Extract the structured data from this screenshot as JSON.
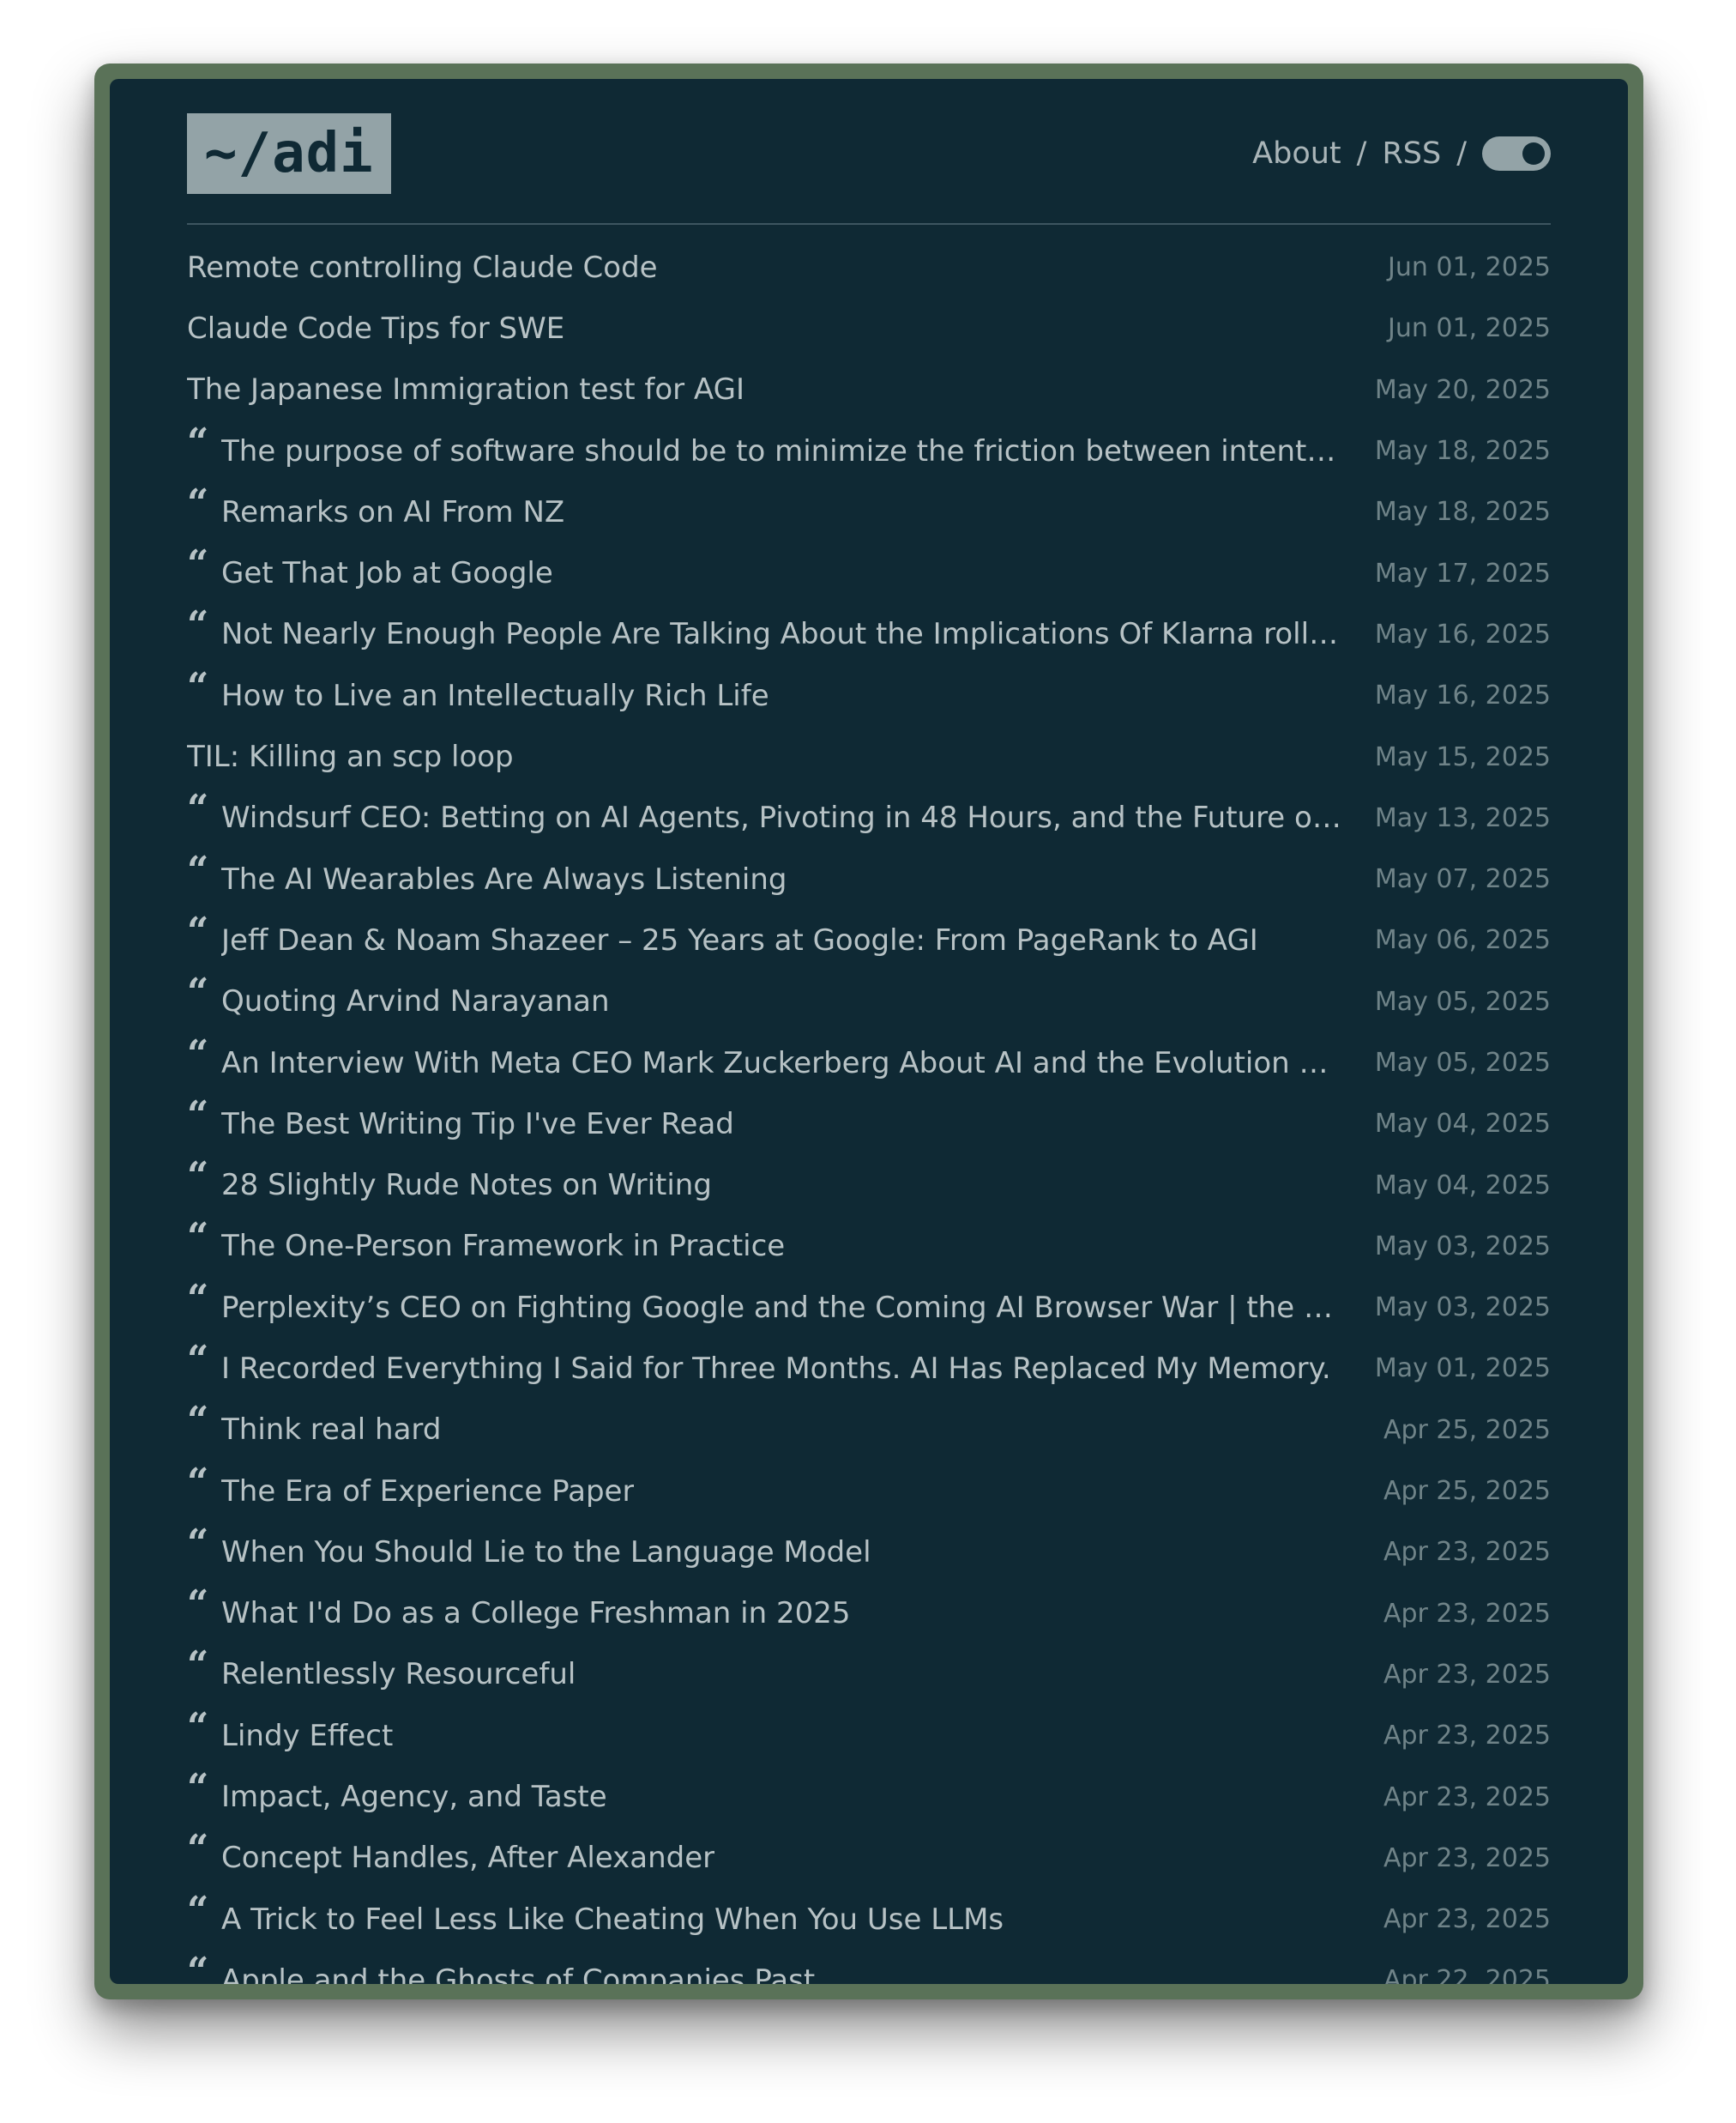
{
  "header": {
    "logo": "~/adi",
    "nav": {
      "about": "About",
      "rss": "RSS",
      "separator": "/"
    },
    "theme_toggle": {
      "state": "on"
    }
  },
  "icons": {
    "quote": "quote-icon"
  },
  "colors": {
    "background": "#0f2934",
    "frame": "#5a7258",
    "text": "#b7c2c5",
    "date": "#6f8388",
    "logo_bg": "#93a3a7"
  },
  "posts": [
    {
      "title": "Remote controlling Claude Code",
      "date": "Jun 01, 2025",
      "quote": false
    },
    {
      "title": "Claude Code Tips for SWE",
      "date": "Jun 01, 2025",
      "quote": false
    },
    {
      "title": "The Japanese Immigration test for AGI",
      "date": "May 20, 2025",
      "quote": false
    },
    {
      "title": "The purpose of software should be to minimize the friction between intent and …",
      "date": "May 18, 2025",
      "quote": true
    },
    {
      "title": "Remarks on AI From NZ",
      "date": "May 18, 2025",
      "quote": true
    },
    {
      "title": "Get That Job at Google",
      "date": "May 17, 2025",
      "quote": true
    },
    {
      "title": "Not Nearly Enough People Are Talking About the Implications Of Klarna rolling b…",
      "date": "May 16, 2025",
      "quote": true
    },
    {
      "title": "How to Live an Intellectually Rich Life",
      "date": "May 16, 2025",
      "quote": true
    },
    {
      "title": "TIL: Killing an scp loop",
      "date": "May 15, 2025",
      "quote": false
    },
    {
      "title": "Windsurf CEO: Betting on AI Agents, Pivoting in 48 Hours, and the Future of Cod…",
      "date": "May 13, 2025",
      "quote": true
    },
    {
      "title": "The AI Wearables Are Always Listening",
      "date": "May 07, 2025",
      "quote": true
    },
    {
      "title": "Jeff Dean & Noam Shazeer – 25 Years at Google: From PageRank to AGI",
      "date": "May 06, 2025",
      "quote": true
    },
    {
      "title": "Quoting Arvind Narayanan",
      "date": "May 05, 2025",
      "quote": true
    },
    {
      "title": "An Interview With Meta CEO Mark Zuckerberg About AI and the Evolution of Soc…",
      "date": "May 05, 2025",
      "quote": true
    },
    {
      "title": "The Best Writing Tip I've Ever Read",
      "date": "May 04, 2025",
      "quote": true
    },
    {
      "title": "28 Slightly Rude Notes on Writing",
      "date": "May 04, 2025",
      "quote": true
    },
    {
      "title": "The One-Person Framework in Practice",
      "date": "May 03, 2025",
      "quote": true
    },
    {
      "title": "Perplexity’s CEO on Fighting Google and the Coming AI Browser War | the Verge",
      "date": "May 03, 2025",
      "quote": true
    },
    {
      "title": "I Recorded Everything I Said for Three Months. AI Has Replaced My Memory.",
      "date": "May 01, 2025",
      "quote": true
    },
    {
      "title": "Think real hard",
      "date": "Apr 25, 2025",
      "quote": true
    },
    {
      "title": "The Era of Experience Paper",
      "date": "Apr 25, 2025",
      "quote": true
    },
    {
      "title": "When You Should Lie to the Language Model",
      "date": "Apr 23, 2025",
      "quote": true
    },
    {
      "title": "What I'd Do as a College Freshman in 2025",
      "date": "Apr 23, 2025",
      "quote": true
    },
    {
      "title": "Relentlessly Resourceful",
      "date": "Apr 23, 2025",
      "quote": true
    },
    {
      "title": "Lindy Effect",
      "date": "Apr 23, 2025",
      "quote": true
    },
    {
      "title": "Impact, Agency, and Taste",
      "date": "Apr 23, 2025",
      "quote": true
    },
    {
      "title": "Concept Handles, After Alexander",
      "date": "Apr 23, 2025",
      "quote": true
    },
    {
      "title": "A Trick to Feel Less Like Cheating When You Use LLMs",
      "date": "Apr 23, 2025",
      "quote": true
    },
    {
      "title": "Apple and the Ghosts of Companies Past",
      "date": "Apr 22, 2025",
      "quote": true
    }
  ]
}
